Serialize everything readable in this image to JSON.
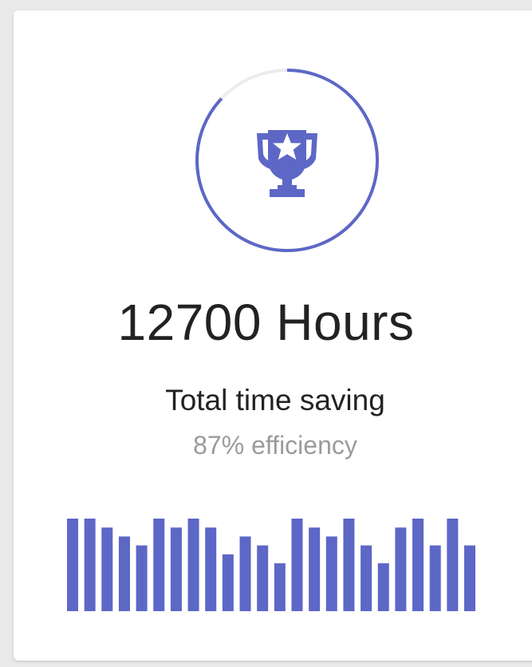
{
  "widget": {
    "value_text": "12700 Hours",
    "label": "Total time saving",
    "efficiency_text": "87% efficiency",
    "progress_fraction": 0.87,
    "icon": "trophy-star-icon",
    "accent_color": "#5d67c6",
    "track_color": "#ececec"
  },
  "chart_data": {
    "type": "bar",
    "values": [
      10,
      10,
      9,
      8,
      7,
      10,
      9,
      10,
      9,
      6,
      8,
      7,
      5,
      10,
      9,
      8,
      10,
      7,
      5,
      9,
      10,
      7,
      10,
      7
    ],
    "ylim": [
      0,
      10
    ]
  }
}
